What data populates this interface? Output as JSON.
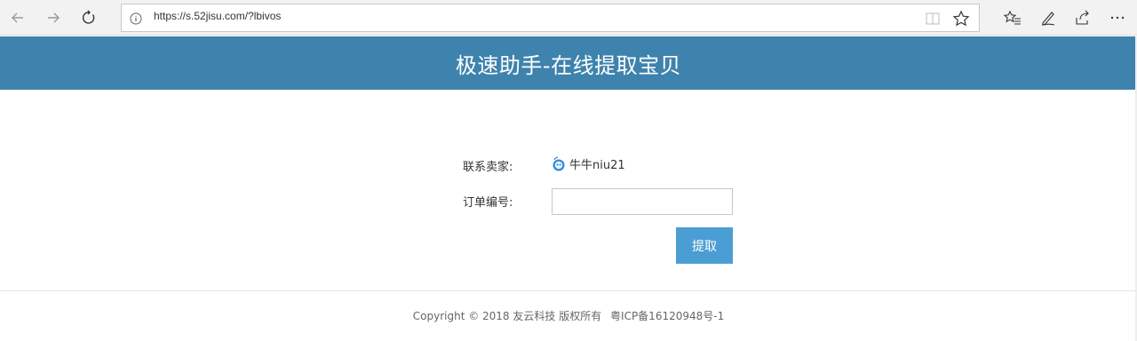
{
  "browser": {
    "url": "https://s.52jisu.com/?lbivos",
    "back_icon": "arrow-left-icon",
    "forward_icon": "arrow-right-icon",
    "refresh_icon": "refresh-icon"
  },
  "header": {
    "title": "极速助手-在线提取宝贝",
    "bg_color": "#3e83ad"
  },
  "form": {
    "seller_label": "联系卖家:",
    "seller_name": "牛牛niu21",
    "order_label": "订单编号:",
    "order_value": "",
    "submit_label": "提取",
    "button_color": "#4a9ed3"
  },
  "footer": {
    "copyright": "Copyright © 2018 友云科技 版权所有",
    "icp": "粤ICP备16120948号-1"
  }
}
